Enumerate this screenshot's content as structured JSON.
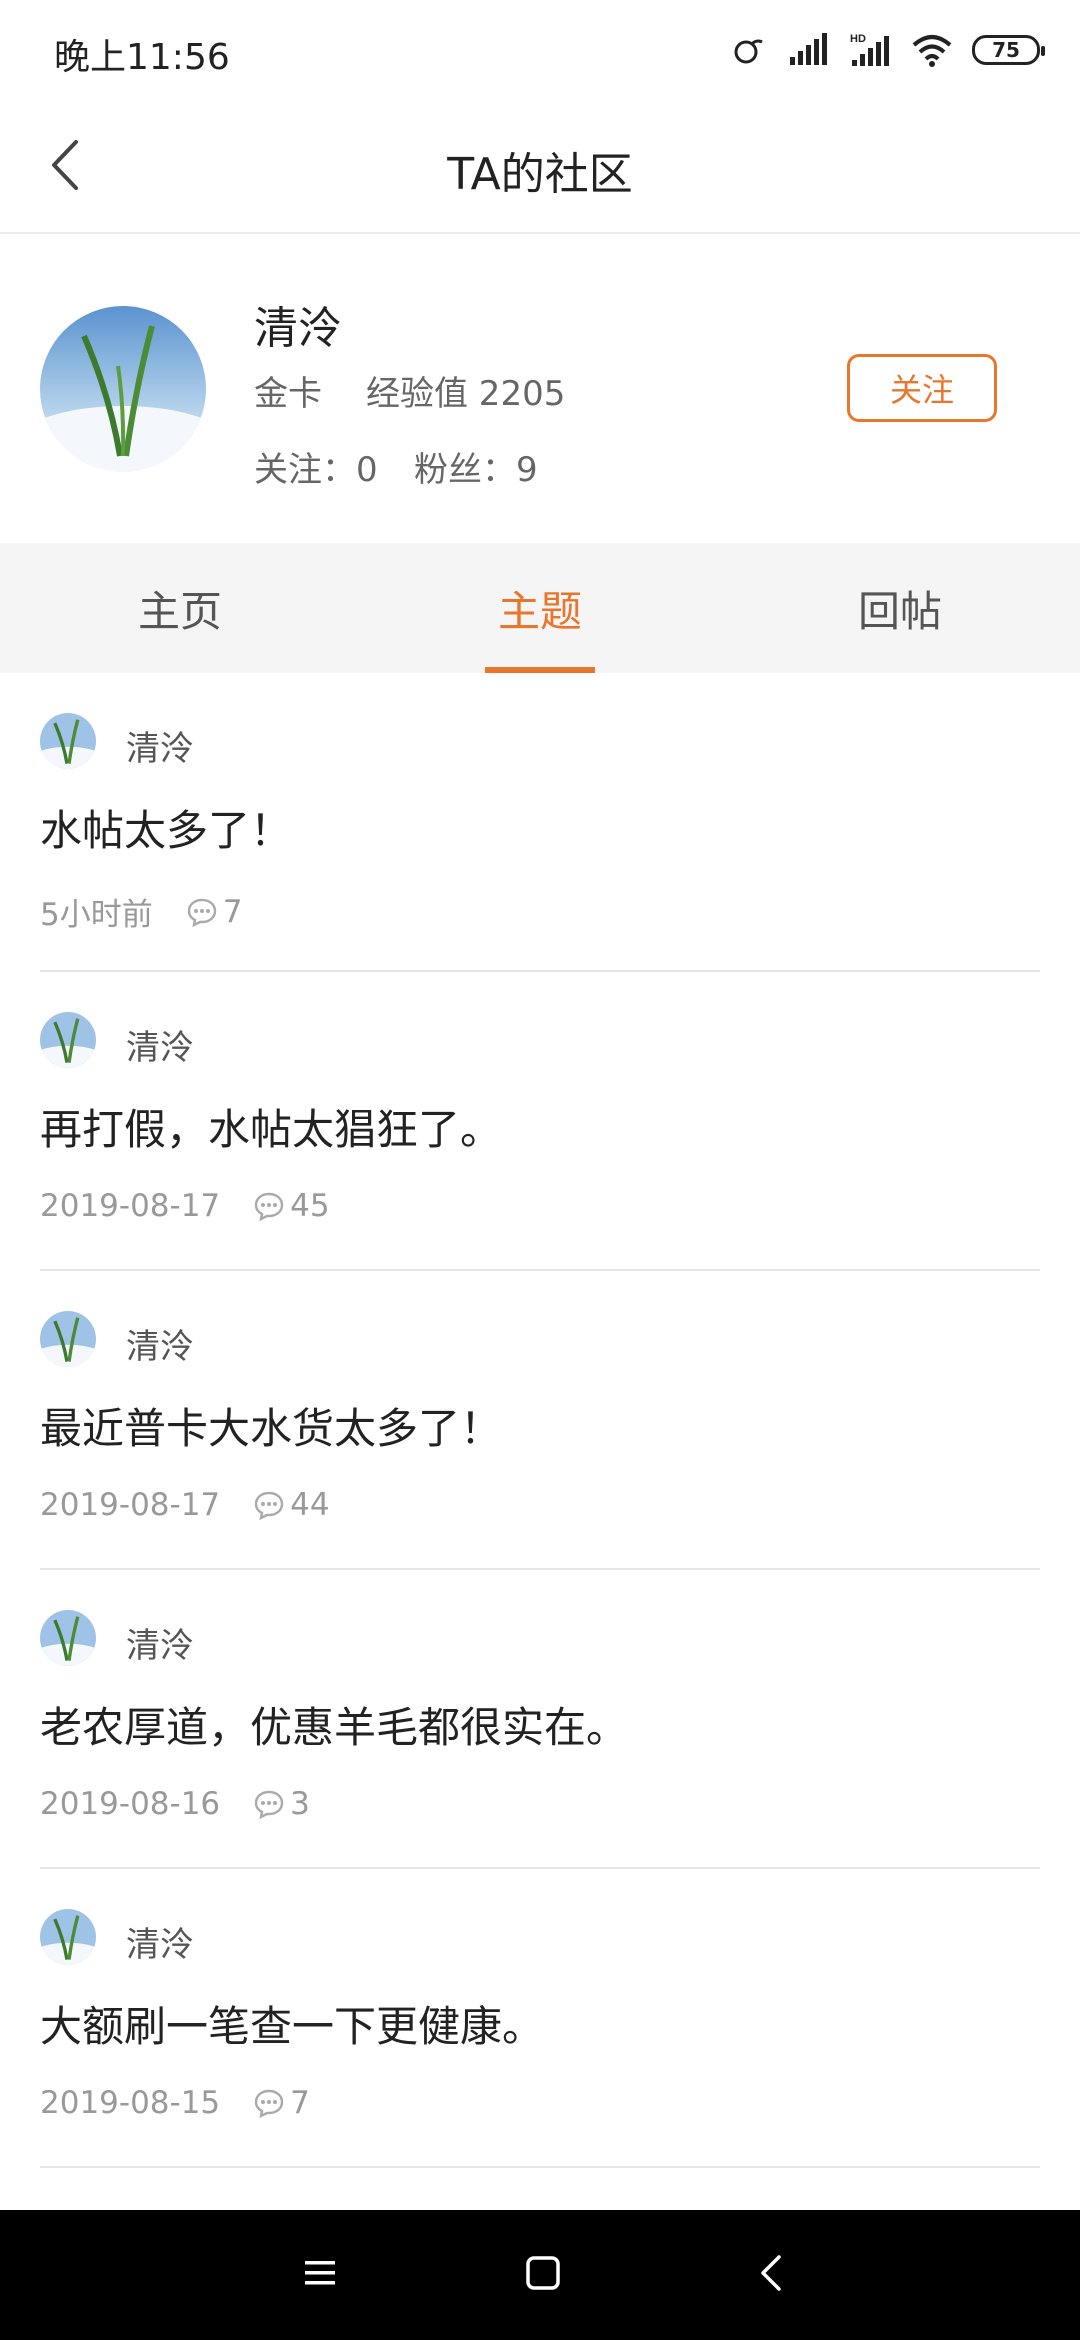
{
  "status_bar": {
    "time": "晚上11:56",
    "battery": "75",
    "icons": [
      "link-icon",
      "signal-icon",
      "hd-signal-icon",
      "wifi-icon",
      "battery-icon"
    ]
  },
  "header": {
    "title": "TA的社区",
    "back_icon": "back-arrow-icon"
  },
  "profile": {
    "name": "清泠",
    "level": "金卡",
    "experience": "经验值 2205",
    "following": "关注：0",
    "fans": "粉丝：9",
    "follow_button": "关注"
  },
  "tabs": [
    {
      "label": "主页",
      "active": false
    },
    {
      "label": "主题",
      "active": true
    },
    {
      "label": "回帖",
      "active": false
    }
  ],
  "posts": [
    {
      "author": "清泠",
      "title": "水帖太多了！",
      "date": "5小时前",
      "comments": "7"
    },
    {
      "author": "清泠",
      "title": "再打假，水帖太猖狂了。",
      "date": "2019-08-17",
      "comments": "45"
    },
    {
      "author": "清泠",
      "title": "最近普卡大水货太多了！",
      "date": "2019-08-17",
      "comments": "44"
    },
    {
      "author": "清泠",
      "title": "老农厚道，优惠羊毛都很实在。",
      "date": "2019-08-16",
      "comments": "3"
    },
    {
      "author": "清泠",
      "title": "大额刷一笔查一下更健康。",
      "date": "2019-08-15",
      "comments": "7"
    }
  ],
  "colors": {
    "accent": "#e8762c",
    "tab_bg": "#f5f5f5",
    "nav_bg": "#000000"
  },
  "nav_bar": {
    "icons": [
      "menu-icon",
      "home-square-icon",
      "back-icon"
    ]
  }
}
